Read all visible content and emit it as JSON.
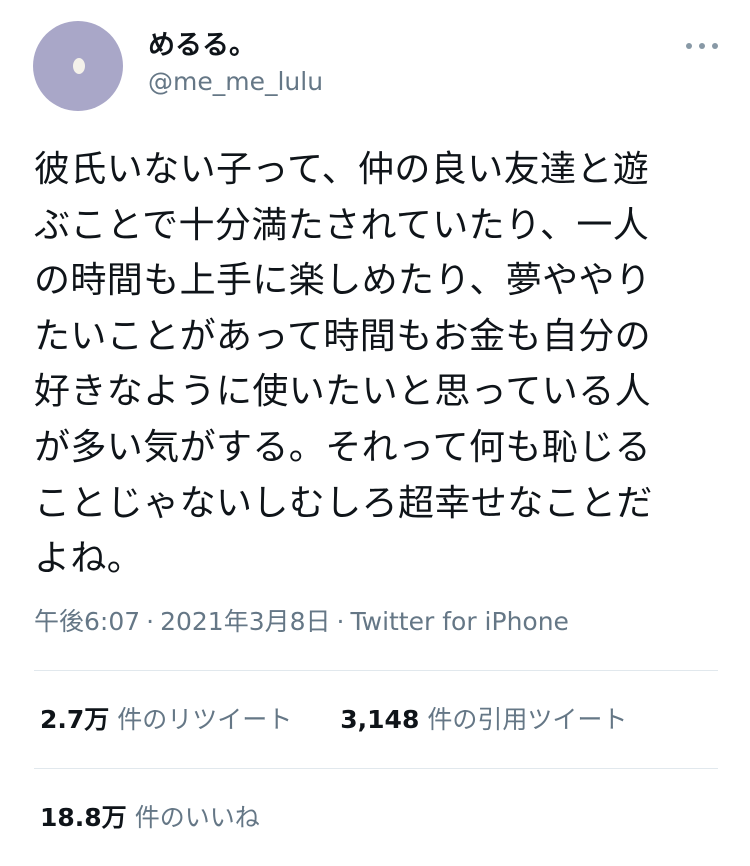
{
  "user": {
    "display_name": "めるる。",
    "handle": "@me_me_lulu"
  },
  "tweet": {
    "lines": [
      "彼氏いない子って、仲の良い友達と遊",
      "ぶことで十分満たされていたり、一人",
      "の時間も上手に楽しめたり、夢ややり",
      "たいことがあって時間もお金も自分の",
      "好きなように使いたいと思っている人",
      "が多い気がする。それって何も恥じる",
      "ことじゃないしむしろ超幸せなことだ",
      "よね。"
    ]
  },
  "meta": {
    "time": "午後6:07",
    "date": "2021年3月8日",
    "source": "Twitter for iPhone",
    "separator": "·"
  },
  "stats": {
    "retweets": {
      "count": "2.7万",
      "label": "件のリツイート"
    },
    "quotes": {
      "count": "3,148",
      "label": "件の引用ツイート"
    },
    "likes": {
      "count": "18.8万",
      "label": "件のいいね"
    }
  },
  "colors": {
    "text": "#0f1419",
    "secondary": "#657786",
    "divider": "#e1e8ed",
    "avatar": "#a9a7c8"
  },
  "icons": {
    "more": "more-horizontal-icon"
  }
}
